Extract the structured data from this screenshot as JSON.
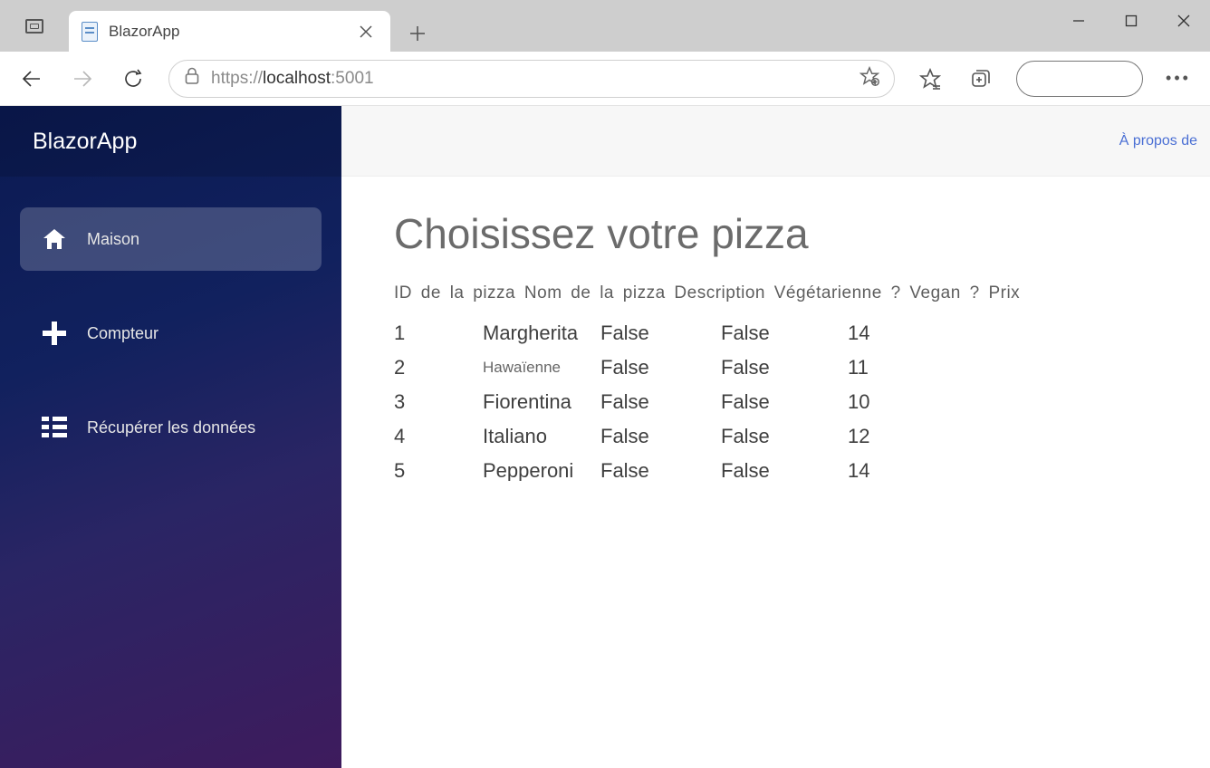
{
  "browser": {
    "tab_title": "BlazorApp",
    "url_prefix": "https://",
    "url_host": "localhost",
    "url_port": ":5001"
  },
  "sidebar": {
    "brand": "BlazorApp",
    "items": [
      {
        "label": "Maison"
      },
      {
        "label": "Compteur"
      },
      {
        "label": "Récupérer les données"
      }
    ]
  },
  "header": {
    "about": "À propos de"
  },
  "page": {
    "title": "Choisissez votre pizza",
    "columns": {
      "id": "ID de la pizza",
      "name": "Nom de la pizza",
      "desc": "Description",
      "veg": "Végétarienne ?",
      "vegan": "Vegan ?",
      "price": "Prix"
    },
    "rows": [
      {
        "id": "1",
        "name": "Margherita",
        "veg": "False",
        "vegan": "False",
        "price": "14"
      },
      {
        "id": "2",
        "name": "Hawaïenne",
        "veg": "False",
        "vegan": "False",
        "price": "11"
      },
      {
        "id": "3",
        "name": "Fiorentina",
        "veg": "False",
        "vegan": "False",
        "price": "10"
      },
      {
        "id": "4",
        "name": "Italiano",
        "veg": "False",
        "vegan": "False",
        "price": "12"
      },
      {
        "id": "5",
        "name": "Pepperoni",
        "veg": "False",
        "vegan": "False",
        "price": "14"
      }
    ]
  }
}
